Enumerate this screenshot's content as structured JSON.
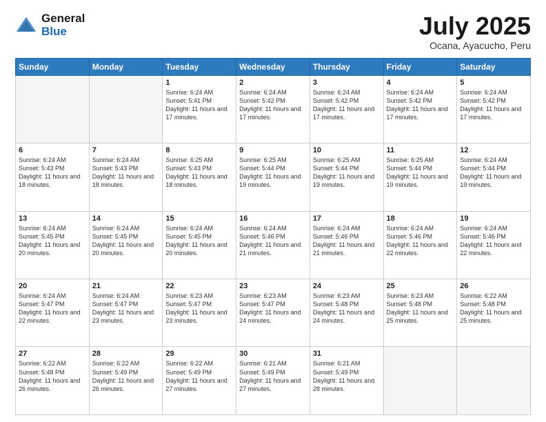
{
  "header": {
    "logo_general": "General",
    "logo_blue": "Blue",
    "month_title": "July 2025",
    "location": "Ocana, Ayacucho, Peru"
  },
  "weekdays": [
    "Sunday",
    "Monday",
    "Tuesday",
    "Wednesday",
    "Thursday",
    "Friday",
    "Saturday"
  ],
  "weeks": [
    [
      {
        "day": "",
        "text": ""
      },
      {
        "day": "",
        "text": ""
      },
      {
        "day": "1",
        "text": "Sunrise: 6:24 AM\nSunset: 5:41 PM\nDaylight: 11 hours and 17 minutes."
      },
      {
        "day": "2",
        "text": "Sunrise: 6:24 AM\nSunset: 5:42 PM\nDaylight: 11 hours and 17 minutes."
      },
      {
        "day": "3",
        "text": "Sunrise: 6:24 AM\nSunset: 5:42 PM\nDaylight: 11 hours and 17 minutes."
      },
      {
        "day": "4",
        "text": "Sunrise: 6:24 AM\nSunset: 5:42 PM\nDaylight: 11 hours and 17 minutes."
      },
      {
        "day": "5",
        "text": "Sunrise: 6:24 AM\nSunset: 5:42 PM\nDaylight: 11 hours and 17 minutes."
      }
    ],
    [
      {
        "day": "6",
        "text": "Sunrise: 6:24 AM\nSunset: 5:43 PM\nDaylight: 11 hours and 18 minutes."
      },
      {
        "day": "7",
        "text": "Sunrise: 6:24 AM\nSunset: 5:43 PM\nDaylight: 11 hours and 18 minutes."
      },
      {
        "day": "8",
        "text": "Sunrise: 6:25 AM\nSunset: 5:43 PM\nDaylight: 11 hours and 18 minutes."
      },
      {
        "day": "9",
        "text": "Sunrise: 6:25 AM\nSunset: 5:44 PM\nDaylight: 11 hours and 19 minutes."
      },
      {
        "day": "10",
        "text": "Sunrise: 6:25 AM\nSunset: 5:44 PM\nDaylight: 11 hours and 19 minutes."
      },
      {
        "day": "11",
        "text": "Sunrise: 6:25 AM\nSunset: 5:44 PM\nDaylight: 11 hours and 19 minutes."
      },
      {
        "day": "12",
        "text": "Sunrise: 6:24 AM\nSunset: 5:44 PM\nDaylight: 11 hours and 19 minutes."
      }
    ],
    [
      {
        "day": "13",
        "text": "Sunrise: 6:24 AM\nSunset: 5:45 PM\nDaylight: 11 hours and 20 minutes."
      },
      {
        "day": "14",
        "text": "Sunrise: 6:24 AM\nSunset: 5:45 PM\nDaylight: 11 hours and 20 minutes."
      },
      {
        "day": "15",
        "text": "Sunrise: 6:24 AM\nSunset: 5:45 PM\nDaylight: 11 hours and 20 minutes."
      },
      {
        "day": "16",
        "text": "Sunrise: 6:24 AM\nSunset: 5:46 PM\nDaylight: 11 hours and 21 minutes."
      },
      {
        "day": "17",
        "text": "Sunrise: 6:24 AM\nSunset: 5:46 PM\nDaylight: 11 hours and 21 minutes."
      },
      {
        "day": "18",
        "text": "Sunrise: 6:24 AM\nSunset: 5:46 PM\nDaylight: 11 hours and 22 minutes."
      },
      {
        "day": "19",
        "text": "Sunrise: 6:24 AM\nSunset: 5:46 PM\nDaylight: 11 hours and 22 minutes."
      }
    ],
    [
      {
        "day": "20",
        "text": "Sunrise: 6:24 AM\nSunset: 5:47 PM\nDaylight: 11 hours and 22 minutes."
      },
      {
        "day": "21",
        "text": "Sunrise: 6:24 AM\nSunset: 5:47 PM\nDaylight: 11 hours and 23 minutes."
      },
      {
        "day": "22",
        "text": "Sunrise: 6:23 AM\nSunset: 5:47 PM\nDaylight: 11 hours and 23 minutes."
      },
      {
        "day": "23",
        "text": "Sunrise: 6:23 AM\nSunset: 5:47 PM\nDaylight: 11 hours and 24 minutes."
      },
      {
        "day": "24",
        "text": "Sunrise: 6:23 AM\nSunset: 5:48 PM\nDaylight: 11 hours and 24 minutes."
      },
      {
        "day": "25",
        "text": "Sunrise: 6:23 AM\nSunset: 5:48 PM\nDaylight: 11 hours and 25 minutes."
      },
      {
        "day": "26",
        "text": "Sunrise: 6:22 AM\nSunset: 5:48 PM\nDaylight: 11 hours and 25 minutes."
      }
    ],
    [
      {
        "day": "27",
        "text": "Sunrise: 6:22 AM\nSunset: 5:48 PM\nDaylight: 11 hours and 26 minutes."
      },
      {
        "day": "28",
        "text": "Sunrise: 6:22 AM\nSunset: 5:49 PM\nDaylight: 11 hours and 26 minutes."
      },
      {
        "day": "29",
        "text": "Sunrise: 6:22 AM\nSunset: 5:49 PM\nDaylight: 11 hours and 27 minutes."
      },
      {
        "day": "30",
        "text": "Sunrise: 6:21 AM\nSunset: 5:49 PM\nDaylight: 11 hours and 27 minutes."
      },
      {
        "day": "31",
        "text": "Sunrise: 6:21 AM\nSunset: 5:49 PM\nDaylight: 11 hours and 28 minutes."
      },
      {
        "day": "",
        "text": ""
      },
      {
        "day": "",
        "text": ""
      }
    ]
  ]
}
